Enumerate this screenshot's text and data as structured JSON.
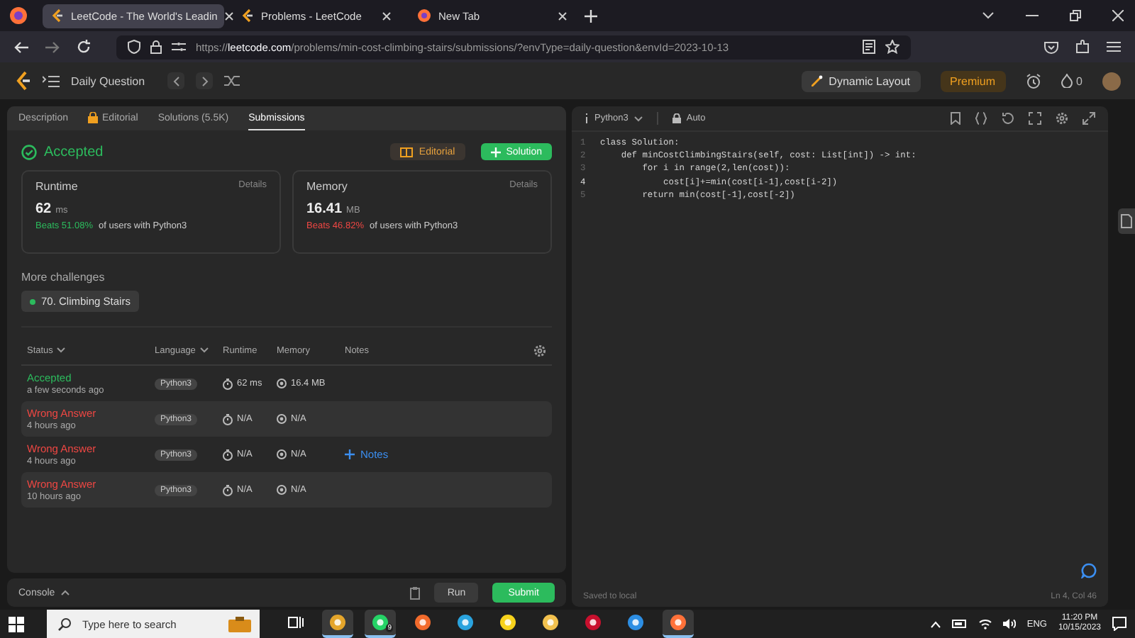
{
  "browser": {
    "tabs": [
      {
        "title": "LeetCode - The World's Leadin",
        "selected": true,
        "kind": "leetcode"
      },
      {
        "title": "Problems - LeetCode",
        "selected": false,
        "kind": "leetcode"
      },
      {
        "title": "New Tab",
        "selected": false,
        "kind": "firefox"
      }
    ],
    "url": {
      "scheme": "https://",
      "host": "leetcode.com",
      "path": "/problems/min-cost-climbing-stairs/submissions/?envType=daily-question&envId=2023-10-13"
    }
  },
  "header": {
    "title": "Daily Question",
    "dynamic_layout": "Dynamic Layout",
    "premium": "Premium",
    "streak": "0"
  },
  "left_tabs": [
    {
      "label": "Description",
      "selected": false,
      "locked": false
    },
    {
      "label": "Editorial",
      "selected": false,
      "locked": true
    },
    {
      "label": "Solutions (5.5K)",
      "selected": false,
      "locked": false
    },
    {
      "label": "Submissions",
      "selected": true,
      "locked": false
    }
  ],
  "result": {
    "status": "Accepted",
    "editorial_button": "Editorial",
    "solution_button": "Solution"
  },
  "stats": [
    {
      "title": "Runtime",
      "details": "Details",
      "value": "62",
      "unit": "ms",
      "beats": "Beats 51.08%",
      "beats_rest": "of users with Python3",
      "color": "#2cbb5d"
    },
    {
      "title": "Memory",
      "details": "Details",
      "value": "16.41",
      "unit": "MB",
      "beats": "Beats 46.82%",
      "beats_rest": "of users with Python3",
      "color": "#ef4743"
    }
  ],
  "more_challenges": {
    "label": "More challenges",
    "items": [
      {
        "label": "70. Climbing Stairs"
      }
    ]
  },
  "submissions": {
    "columns": [
      {
        "label": "Status",
        "sortable": true
      },
      {
        "label": "Language",
        "sortable": true
      },
      {
        "label": "Runtime",
        "sortable": false
      },
      {
        "label": "Memory",
        "sortable": false
      },
      {
        "label": "Notes",
        "sortable": false
      }
    ],
    "rows": [
      {
        "status": "Accepted",
        "kind": "accepted",
        "time": "a few seconds ago",
        "language": "Python3",
        "runtime": "62 ms",
        "memory": "16.4 MB"
      },
      {
        "status": "Wrong Answer",
        "kind": "wrong",
        "time": "4 hours ago",
        "language": "Python3",
        "runtime": "N/A",
        "memory": "N/A"
      },
      {
        "status": "Wrong Answer",
        "kind": "wrong",
        "time": "4 hours ago",
        "language": "Python3",
        "runtime": "N/A",
        "memory": "N/A",
        "notes": "Notes"
      },
      {
        "status": "Wrong Answer",
        "kind": "wrong",
        "time": "10 hours ago",
        "language": "Python3",
        "runtime": "N/A",
        "memory": "N/A"
      }
    ]
  },
  "console": {
    "label": "Console",
    "run": "Run",
    "submit": "Submit"
  },
  "editor": {
    "language": "Python3",
    "mode": "Auto",
    "lines": [
      {
        "number": "1",
        "code": "class Solution:",
        "current": false
      },
      {
        "number": "2",
        "code": "    def minCostClimbingStairs(self, cost: List[int]) -> int:",
        "current": false
      },
      {
        "number": "3",
        "code": "        for i in range(2,len(cost)):",
        "current": false
      },
      {
        "number": "4",
        "code": "            cost[i]+=min(cost[i-1],cost[i-2])",
        "current": true
      },
      {
        "number": "5",
        "code": "        return min(cost[-1],cost[-2])",
        "current": false
      }
    ],
    "status": "Saved to local",
    "position": "Ln 4, Col 46"
  },
  "taskbar": {
    "search_placeholder": "Type here to search",
    "apps": [
      {
        "kind": "task-view",
        "running": false,
        "active": false
      },
      {
        "kind": "chrome",
        "running": true,
        "active": false
      },
      {
        "kind": "whatsapp",
        "running": true,
        "active": false,
        "badge": "9"
      },
      {
        "kind": "brave",
        "running": false,
        "active": false
      },
      {
        "kind": "telegram",
        "running": false,
        "active": false
      },
      {
        "kind": "notes",
        "running": false,
        "active": false
      },
      {
        "kind": "folder",
        "running": false,
        "active": false
      },
      {
        "kind": "app",
        "running": false,
        "active": false
      },
      {
        "kind": "vscode",
        "running": false,
        "active": false
      },
      {
        "kind": "firefox",
        "running": true,
        "active": true
      }
    ],
    "language": "ENG",
    "time": "11:20 PM",
    "date": "10/15/2023"
  }
}
